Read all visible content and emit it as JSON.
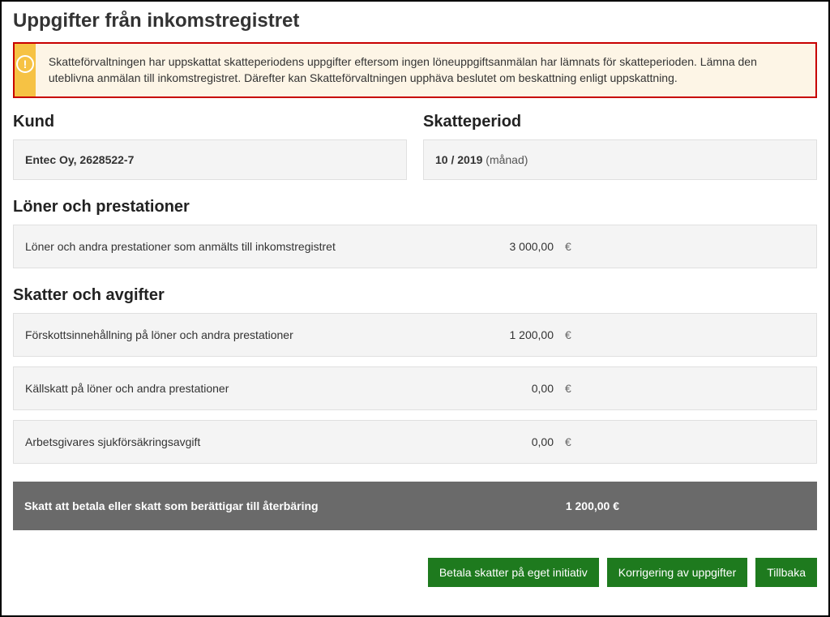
{
  "page_title": "Uppgifter från inkomstregistret",
  "alert": {
    "icon_glyph": "!",
    "text": "Skatteförvaltningen har uppskattat skatteperiodens uppgifter eftersom ingen löneuppgiftsanmälan har lämnats för skatteperioden. Lämna den uteblivna anmälan till inkomstregistret. Därefter kan Skatteförvaltningen upphäva beslutet om beskattning enligt uppskattning."
  },
  "customer": {
    "heading": "Kund",
    "value": "Entec Oy, 2628522-7"
  },
  "tax_period": {
    "heading": "Skatteperiod",
    "value_strong": "10 / 2019",
    "value_muted": "(månad)"
  },
  "wages_section": {
    "heading": "Löner och prestationer",
    "rows": [
      {
        "label": "Löner och andra prestationer som anmälts till inkomstregistret",
        "amount": "3 000,00",
        "currency": "€"
      }
    ]
  },
  "taxes_section": {
    "heading": "Skatter och avgifter",
    "rows": [
      {
        "label": "Förskottsinnehållning på löner och andra prestationer",
        "amount": "1 200,00",
        "currency": "€"
      },
      {
        "label": "Källskatt på löner och andra prestationer",
        "amount": "0,00",
        "currency": "€"
      },
      {
        "label": "Arbetsgivares sjukförsäkringsavgift",
        "amount": "0,00",
        "currency": "€"
      }
    ]
  },
  "total": {
    "label": "Skatt att betala eller skatt som berättigar till återbäring",
    "amount": "1 200,00 €"
  },
  "buttons": {
    "pay": "Betala skatter på eget initiativ",
    "correct": "Korrigering av uppgifter",
    "back": "Tillbaka"
  }
}
